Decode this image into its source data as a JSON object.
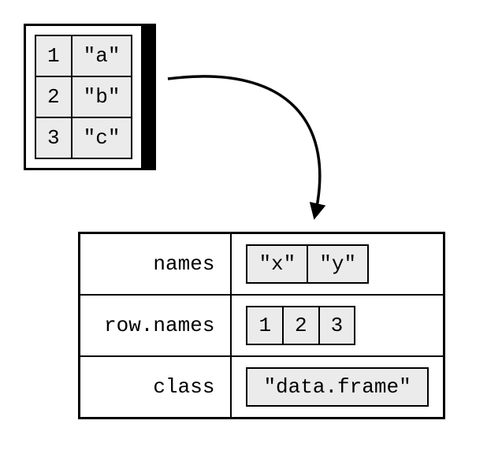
{
  "source": {
    "col0": [
      "1",
      "2",
      "3"
    ],
    "col1": [
      "\"a\"",
      "\"b\"",
      "\"c\""
    ]
  },
  "attributes": {
    "names": {
      "label": "names",
      "values": [
        "\"x\"",
        "\"y\""
      ]
    },
    "row_names": {
      "label": "row.names",
      "values": [
        "1",
        "2",
        "3"
      ]
    },
    "class": {
      "label": "class",
      "value": "\"data.frame\""
    }
  }
}
